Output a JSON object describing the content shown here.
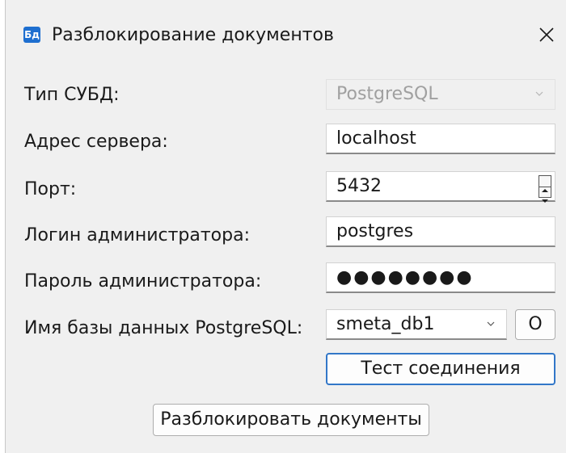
{
  "window": {
    "title": "Разблокирование документов",
    "icon_text": "Бд"
  },
  "form": {
    "dbms_type": {
      "label": "Тип СУБД:",
      "value": "PostgreSQL",
      "enabled": false
    },
    "server_address": {
      "label": "Адрес сервера:",
      "value": "localhost"
    },
    "port": {
      "label": "Порт:",
      "value": "5432"
    },
    "admin_login": {
      "label": "Логин администратора:",
      "value": "postgres"
    },
    "admin_password": {
      "label": "Пароль администратора:",
      "value": "●●●●●●●●"
    },
    "database_name": {
      "label": "Имя базы данных PostgreSQL:",
      "value": "smeta_db1",
      "browse_label": "O"
    }
  },
  "buttons": {
    "test_connection": "Тест соединения",
    "unlock_documents": "Разблокировать документы"
  },
  "colors": {
    "accent": "#3277c8",
    "app_icon": "#1e6fd0"
  }
}
